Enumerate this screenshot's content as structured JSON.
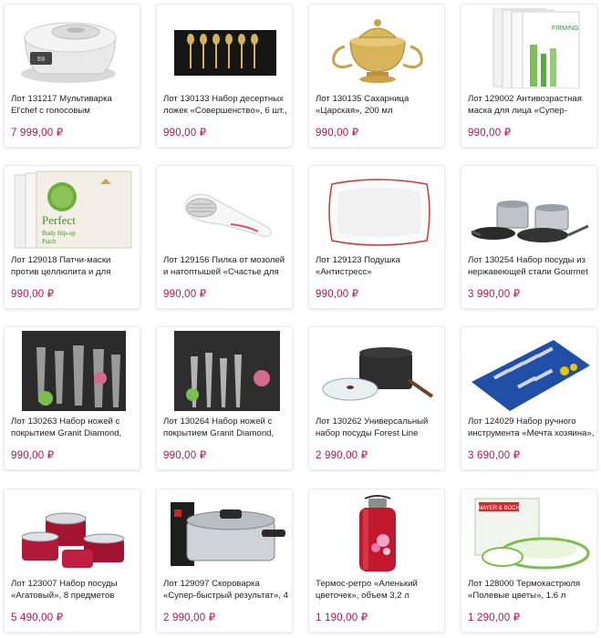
{
  "products": [
    {
      "title": "Лот 131217 Мультиварка El'chef с голосовым",
      "price": "7 999,00 ₽",
      "icon": "multicooker-image"
    },
    {
      "title": "Лот 130133 Набор десертных ложек «Совершенство», 6 шт.,",
      "price": "990,00 ₽",
      "icon": "spoons-image"
    },
    {
      "title": "Лот 130135 Сахарница «Царская», 200 мл",
      "price": "990,00 ₽",
      "icon": "sugar-bowl-image"
    },
    {
      "title": "Лот 129002 Антивозрастная маска для лица «Супер-",
      "price": "990,00 ₽",
      "icon": "face-mask-image"
    },
    {
      "title": "Лот 129018 Патчи-маски против целлюлита и для",
      "price": "990,00 ₽",
      "icon": "patch-mask-image"
    },
    {
      "title": "Лот 129156 Пилка от мозолей и натоптышей «Счастье для",
      "price": "990,00 ₽",
      "icon": "foot-file-image"
    },
    {
      "title": "Лот 129123 Подушка «Антистресс»",
      "price": "990,00 ₽",
      "icon": "pillow-image"
    },
    {
      "title": "Лот 130254 Набор посуды из нержавеющей стали Gourmet",
      "price": "3 990,00 ₽",
      "icon": "steel-cookware-image"
    },
    {
      "title": "Лот 130263 Набор ножей с покрытием Granit Diamond,",
      "price": "990,00 ₽",
      "icon": "knife-set-image"
    },
    {
      "title": "Лот 130264 Набор ножей с покрытием Granit Diamond,",
      "price": "990,00 ₽",
      "icon": "knife-set-2-image"
    },
    {
      "title": "Лот 130262 Универсальный набор посуды Forest Line",
      "price": "2 990,00 ₽",
      "icon": "forest-cookware-image"
    },
    {
      "title": "Лот 124029 Набор ручного инструмента «Мечта хозяина»,",
      "price": "3 690,00 ₽",
      "icon": "tool-set-image"
    },
    {
      "title": "Лот 123007 Набор посуды «Агатовый», 8 предметов",
      "price": "5 490,00 ₽",
      "icon": "red-cookware-image"
    },
    {
      "title": "Лот 129097 Скороварка «Супер-быстрый результат», 4",
      "price": "2 990,00 ₽",
      "icon": "pressure-cooker-image"
    },
    {
      "title": "Термос-ретро «Аленький цветочек», объем 3,2 л",
      "price": "1 190,00 ₽",
      "icon": "thermos-image"
    },
    {
      "title": "Лот 128000 Термокастрюля «Полевые цветы», 1.6 л",
      "price": "1 290,00 ₽",
      "icon": "thermo-pot-image"
    }
  ],
  "thumb_text": {
    "patch_brand": "Perfect",
    "patch_sub1": "Body Hip-up",
    "patch_sub2": "Patch",
    "mask_brand": "FIRMING",
    "tools_brand": "MAYER & BOCH"
  },
  "colors": {
    "price": "#b0174f",
    "card_border": "#ececec"
  }
}
